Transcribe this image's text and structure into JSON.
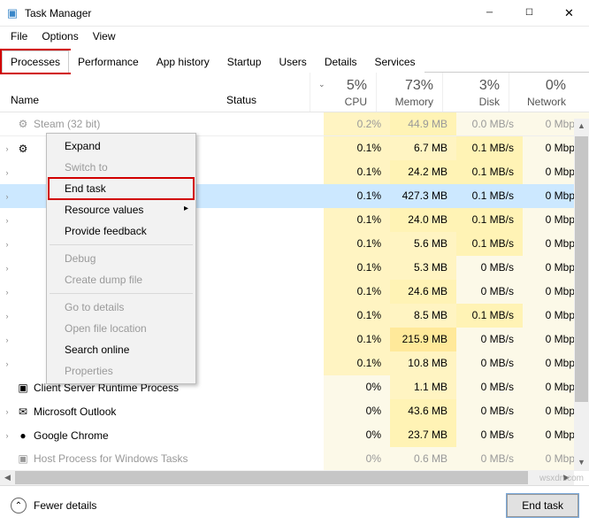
{
  "window": {
    "title": "Task Manager"
  },
  "menu": {
    "file": "File",
    "options": "Options",
    "view": "View"
  },
  "tabs": [
    "Processes",
    "Performance",
    "App history",
    "Startup",
    "Users",
    "Details",
    "Services"
  ],
  "columns": {
    "name": "Name",
    "status": "Status",
    "cpu": {
      "pct": "5%",
      "label": "CPU"
    },
    "memory": {
      "pct": "73%",
      "label": "Memory"
    },
    "disk": {
      "pct": "3%",
      "label": "Disk"
    },
    "network": {
      "pct": "0%",
      "label": "Network"
    }
  },
  "context_menu": {
    "expand": "Expand",
    "switch": "Switch to",
    "end": "End task",
    "resources": "Resource values",
    "feedback": "Provide feedback",
    "debug": "Debug",
    "dump": "Create dump file",
    "details": "Go to details",
    "loc": "Open file location",
    "search": "Search online",
    "props": "Properties"
  },
  "rows": [
    {
      "chev": "",
      "icon": "⚙",
      "name": "Steam (32 bit)",
      "cpu": "0.2%",
      "mem": "44.9 MB",
      "disk": "0.0 MB/s",
      "net": "0 Mbps",
      "cls": [
        "c1",
        "c2",
        "cw",
        "cw"
      ],
      "cut": true
    },
    {
      "chev": "›",
      "icon": "⚙",
      "name": " ",
      "cpu": "0.1%",
      "mem": "6.7 MB",
      "disk": "0.1 MB/s",
      "net": "0 Mbps",
      "cls": [
        "c1",
        "c1",
        "c2",
        "cw"
      ]
    },
    {
      "chev": "›",
      "icon": "",
      "name": "",
      "cpu": "0.1%",
      "mem": "24.2 MB",
      "disk": "0.1 MB/s",
      "net": "0 Mbps",
      "cls": [
        "c1",
        "c2",
        "c2",
        "cw"
      ]
    },
    {
      "chev": "›",
      "icon": "",
      "name": "",
      "cpu": "0.1%",
      "mem": "427.3 MB",
      "disk": "0.1 MB/s",
      "net": "0 Mbps",
      "sel": true,
      "cls": [
        "",
        "",
        "",
        ""
      ]
    },
    {
      "chev": "›",
      "icon": "",
      "name": "",
      "cpu": "0.1%",
      "mem": "24.0 MB",
      "disk": "0.1 MB/s",
      "net": "0 Mbps",
      "cls": [
        "c1",
        "c2",
        "c2",
        "cw"
      ]
    },
    {
      "chev": "›",
      "icon": "",
      "name": "",
      "cpu": "0.1%",
      "mem": "5.6 MB",
      "disk": "0.1 MB/s",
      "net": "0 Mbps",
      "cls": [
        "c1",
        "c1",
        "c2",
        "cw"
      ]
    },
    {
      "chev": "›",
      "icon": "",
      "name": "",
      "cpu": "0.1%",
      "mem": "5.3 MB",
      "disk": "0 MB/s",
      "net": "0 Mbps",
      "cls": [
        "c1",
        "c1",
        "cw",
        "cw"
      ]
    },
    {
      "chev": "›",
      "icon": "",
      "name": "",
      "cpu": "0.1%",
      "mem": "24.6 MB",
      "disk": "0 MB/s",
      "net": "0 Mbps",
      "cls": [
        "c1",
        "c2",
        "cw",
        "cw"
      ]
    },
    {
      "chev": "›",
      "icon": "",
      "name": "",
      "cpu": "0.1%",
      "mem": "8.5 MB",
      "disk": "0.1 MB/s",
      "net": "0 Mbps",
      "cls": [
        "c1",
        "c1",
        "c2",
        "cw"
      ]
    },
    {
      "chev": "›",
      "icon": "",
      "name": "",
      "cpu": "0.1%",
      "mem": "215.9 MB",
      "disk": "0 MB/s",
      "net": "0 Mbps",
      "cls": [
        "c1",
        "c3",
        "cw",
        "cw"
      ]
    },
    {
      "chev": "›",
      "icon": "",
      "name": "",
      "cpu": "0.1%",
      "mem": "10.8 MB",
      "disk": "0 MB/s",
      "net": "0 Mbps",
      "cls": [
        "c1",
        "c1",
        "cw",
        "cw"
      ]
    },
    {
      "chev": "",
      "icon": "▣",
      "name": "Client Server Runtime Process",
      "cpu": "0%",
      "mem": "1.1 MB",
      "disk": "0 MB/s",
      "net": "0 Mbps",
      "cls": [
        "cw",
        "c1",
        "cw",
        "cw"
      ]
    },
    {
      "chev": "›",
      "icon": "✉",
      "name": "Microsoft Outlook",
      "cpu": "0%",
      "mem": "43.6 MB",
      "disk": "0 MB/s",
      "net": "0 Mbps",
      "cls": [
        "cw",
        "c2",
        "cw",
        "cw"
      ]
    },
    {
      "chev": "›",
      "icon": "●",
      "name": "Google Chrome",
      "cpu": "0%",
      "mem": "23.7 MB",
      "disk": "0 MB/s",
      "net": "0 Mbps",
      "cls": [
        "cw",
        "c2",
        "cw",
        "cw"
      ]
    },
    {
      "chev": "",
      "icon": "▣",
      "name": "Host Process for Windows Tasks",
      "cpu": "0%",
      "mem": "0.6 MB",
      "disk": "0 MB/s",
      "net": "0 Mbps",
      "cls": [
        "cw",
        "cw",
        "cw",
        "cw"
      ],
      "cut": true
    }
  ],
  "footer": {
    "fewer": "Fewer details",
    "end": "End task"
  },
  "watermark": "wsxdn.com"
}
